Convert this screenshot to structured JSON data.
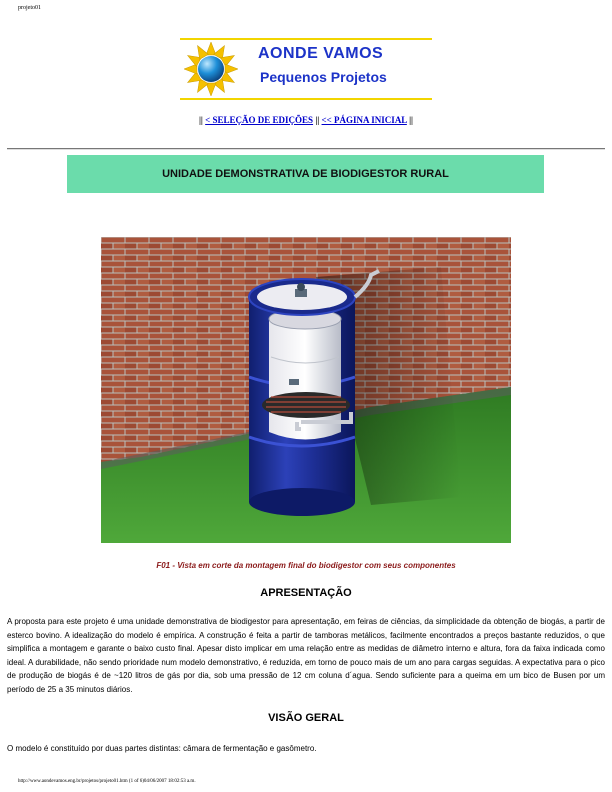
{
  "page_header": "projeto01",
  "logo": {
    "title": "AONDE VAMOS",
    "subtitle": "Pequenos Projetos",
    "colors": {
      "text": "#1c33c8",
      "line": "#f2d500",
      "sun": "#f5c000",
      "globe": "#1d8fd8"
    }
  },
  "nav": {
    "sep": "||",
    "link1": "< SELEÇÃO DE EDIÇÕES",
    "link2": "<< PÁGINA INICIAL"
  },
  "section_title": "UNIDADE DEMONSTRATIVA DE BIODIGESTOR RURAL",
  "figure": {
    "caption": "F01 - Vista em corte da montagem final do biodigestor com seus componentes"
  },
  "headings": {
    "apresentacao": "APRESENTAÇÃO",
    "visao_geral": "VISÃO GERAL"
  },
  "paragraphs": {
    "apresentacao": "A proposta para este projeto é uma unidade demonstrativa de biodigestor para apresentação, em feiras de ciências, da simplicidade da obtenção de biogás, a partir de esterco bovino. A idealização do modelo é empírica. A construção é feita a partir de tamboras metálicos, facilmente encontrados a preços bastante reduzidos, o que simplifica a montagem e garante o baixo custo final. Apesar disto implicar em uma relação entre as medidas de diâmetro interno e altura, fora da faixa indicada como ideal. A durabilidade, não sendo prioridade num modelo demonstrativo, é reduzida, em torno de pouco mais de um ano para cargas seguidas. A expectativa para o pico de produção de biogás é de ~120 litros de gás por dia, sob uma pressão de 12 cm coluna d´agua. Sendo suficiente para a queima em um bico de Busen por um período de 25 a 35 minutos diários.",
    "visao_geral": "O modelo é constituído por duas partes distintas: câmara de fermentação e gasômetro."
  },
  "footer": "http://www.aondevamos.eng.br/projetos/projeto01.htm (1 of 6)04/06/2007 18:02:53 a.m."
}
